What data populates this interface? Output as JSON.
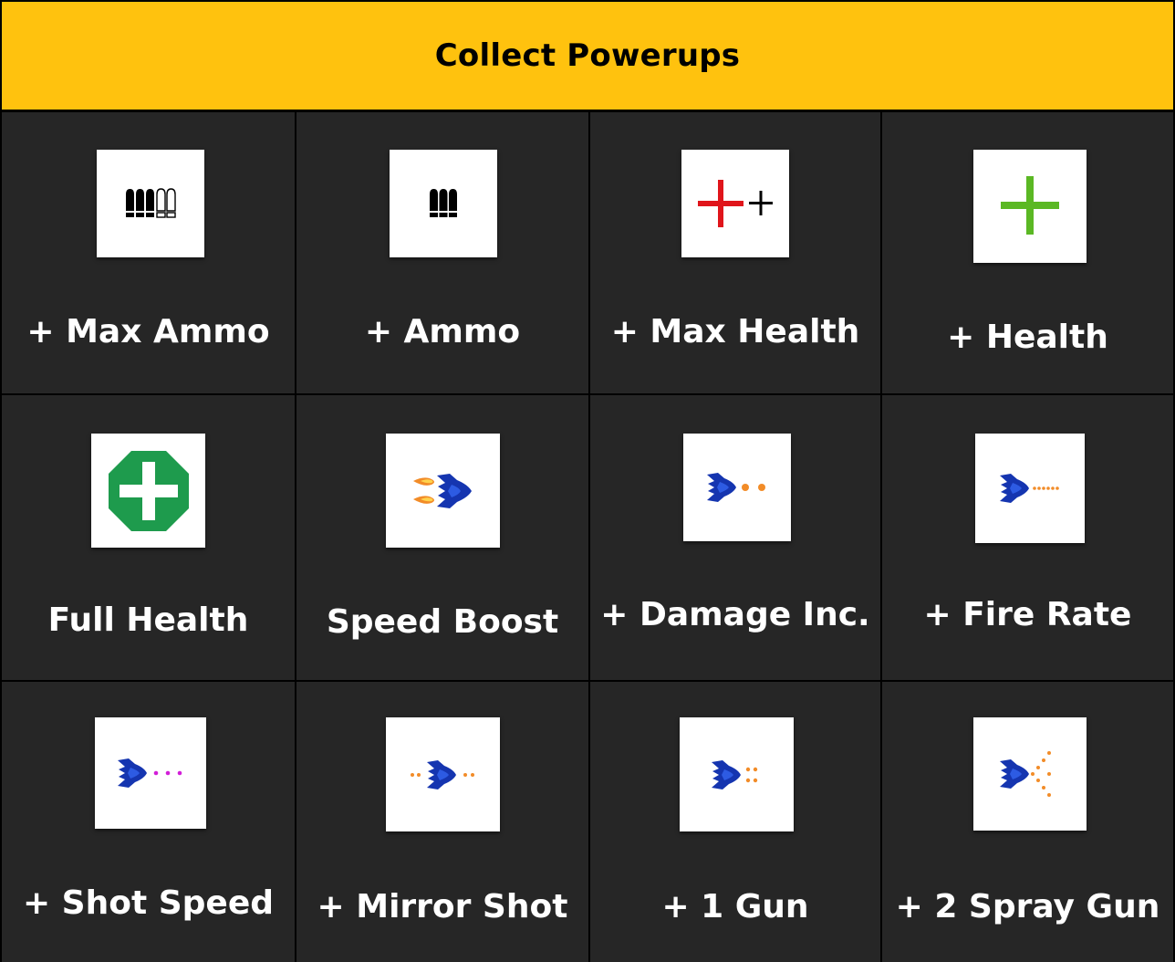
{
  "header": {
    "title": "Collect Powerups"
  },
  "colors": {
    "header_bg": "#FFC20E",
    "cell_bg": "#262626",
    "label_text": "#FFFFFF",
    "grid_lines": "#000000"
  },
  "powerups": [
    {
      "label": "+ Max Ammo",
      "icon": "max-ammo-icon"
    },
    {
      "label": "+ Ammo",
      "icon": "ammo-icon"
    },
    {
      "label": "+ Max Health",
      "icon": "max-health-icon"
    },
    {
      "label": "+ Health",
      "icon": "health-icon"
    },
    {
      "label": "Full Health",
      "icon": "full-health-icon"
    },
    {
      "label": "Speed Boost",
      "icon": "speed-boost-icon"
    },
    {
      "label": "+ Damage Inc.",
      "icon": "damage-increase-icon"
    },
    {
      "label": "+ Fire Rate",
      "icon": "fire-rate-icon"
    },
    {
      "label": "+ Shot Speed",
      "icon": "shot-speed-icon"
    },
    {
      "label": "+ Mirror Shot",
      "icon": "mirror-shot-icon"
    },
    {
      "label": "+ 1 Gun",
      "icon": "one-gun-icon"
    },
    {
      "label": "+ 2 Spray Gun",
      "icon": "spray-gun-icon"
    }
  ]
}
